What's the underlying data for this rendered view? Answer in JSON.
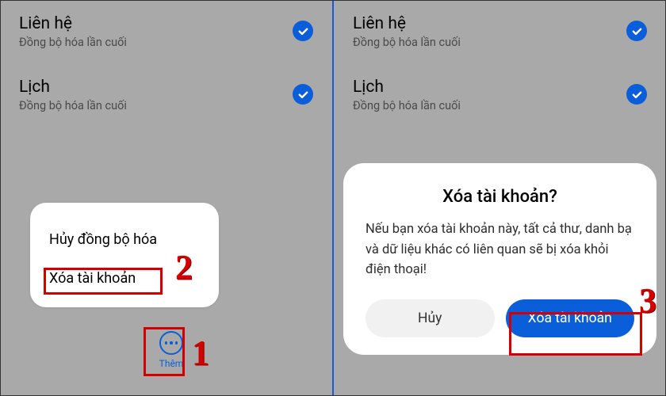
{
  "left": {
    "rows": [
      {
        "title": "Liên hệ",
        "sub": "Đồng bộ hóa lần cuối"
      },
      {
        "title": "Lịch",
        "sub": "Đồng bộ hóa lần cuối"
      }
    ],
    "popup": {
      "cancel_sync": "Hủy đồng bộ hóa",
      "delete_account": "Xóa tài khoản"
    },
    "more_label": "Thêm"
  },
  "right": {
    "rows": [
      {
        "title": "Liên hệ",
        "sub": "Đồng bộ hóa lần cuối"
      },
      {
        "title": "Lịch",
        "sub": "Đồng bộ hóa lần cuối"
      }
    ],
    "dialog": {
      "title": "Xóa tài khoản?",
      "body": "Nếu bạn xóa tài khoản này, tất cả thư, danh bạ và dữ liệu khác có liên quan sẽ bị xóa khỏi điện thoại!",
      "cancel": "Hủy",
      "confirm": "Xóa tài khoản"
    }
  },
  "steps": {
    "s1": "1",
    "s2": "2",
    "s3": "3"
  },
  "colors": {
    "accent": "#0a5ed9",
    "highlight": "#d40000"
  }
}
